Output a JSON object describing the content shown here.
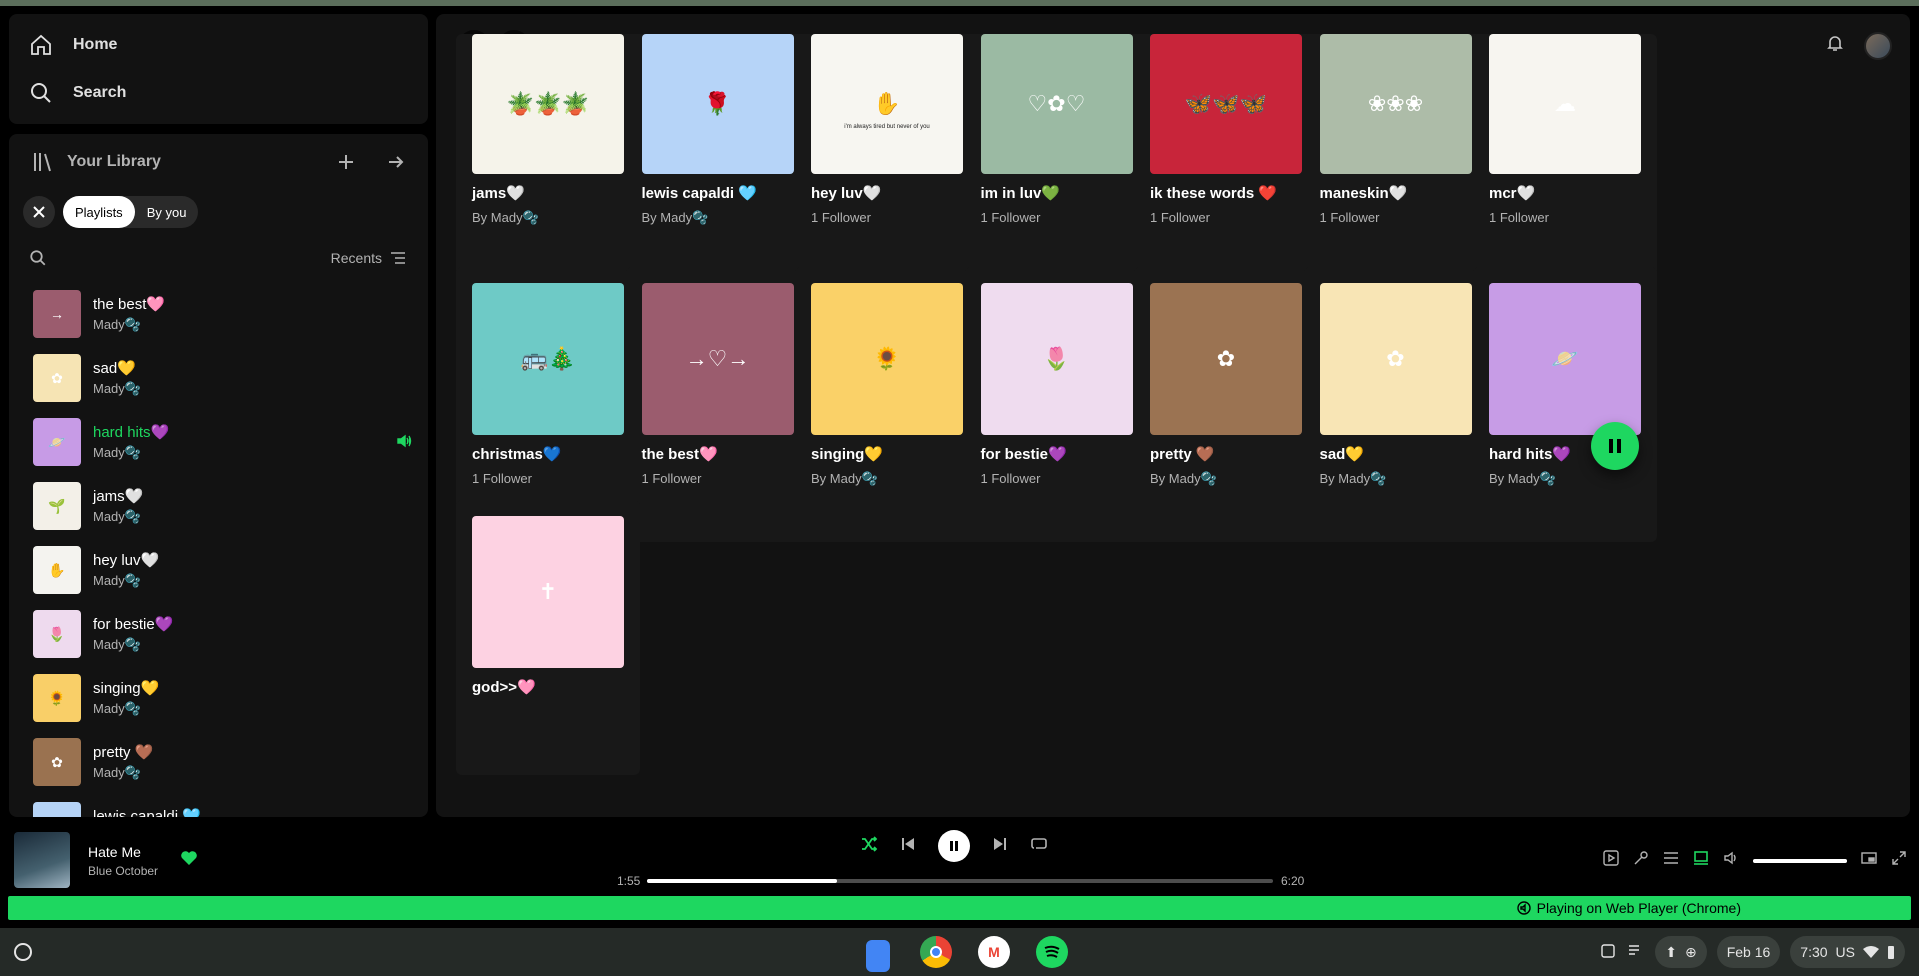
{
  "nav": {
    "home": "Home",
    "search": "Search"
  },
  "library": {
    "title": "Your Library",
    "chips": [
      "Playlists",
      "By you"
    ],
    "sort_label": "Recents",
    "items": [
      {
        "title": "the best🩷",
        "sub": "Mady🫧",
        "color": "#9b5c6e",
        "glyph": "→"
      },
      {
        "title": "sad💛",
        "sub": "Mady🫧",
        "color": "#f6e4b4",
        "glyph": "✿"
      },
      {
        "title": "hard hits💜",
        "sub": "Mady🫧",
        "color": "#c79be6",
        "glyph": "🪐",
        "playing": true
      },
      {
        "title": "jams🤍",
        "sub": "Mady🫧",
        "color": "#f3f0e8",
        "glyph": "🌱"
      },
      {
        "title": "hey luv🤍",
        "sub": "Mady🫧",
        "color": "#f4f3ef",
        "glyph": "✋"
      },
      {
        "title": "for bestie💜",
        "sub": "Mady🫧",
        "color": "#eedaee",
        "glyph": "🌷"
      },
      {
        "title": "singing💛",
        "sub": "Mady🫧",
        "color": "#f9cf68",
        "glyph": "🌻"
      },
      {
        "title": "pretty 🤎",
        "sub": "Mady🫧",
        "color": "#9a7250",
        "glyph": "✿"
      },
      {
        "title": "lewis capaldi 🩵",
        "sub": "Mady🫧",
        "color": "#b5d3f6",
        "glyph": "🌹"
      }
    ]
  },
  "cards": [
    {
      "title": "jams🤍",
      "sub": "By Mady🫧",
      "color": "#f5f3ea",
      "glyph": "🪴🪴🪴"
    },
    {
      "title": "lewis capaldi 🩵",
      "sub": "By Mady🫧",
      "color": "#b6d4f8",
      "glyph": "🌹"
    },
    {
      "title": "hey luv🤍",
      "sub": "1 Follower",
      "color": "#f7f6f1",
      "glyph": "✋",
      "caption": "i'm always tired but never of you"
    },
    {
      "title": "im in luv💚",
      "sub": "1 Follower",
      "color": "#9bbaa3",
      "glyph": "♡✿♡"
    },
    {
      "title": "ik these words ❤️",
      "sub": "1 Follower",
      "color": "#c8253a",
      "glyph": "🦋🦋🦋"
    },
    {
      "title": "maneskin🤍",
      "sub": "1 Follower",
      "color": "#adbca8",
      "glyph": "❀❀❀"
    },
    {
      "title": "mcr🤍",
      "sub": "1 Follower",
      "color": "#f7f5f0",
      "glyph": "☁"
    },
    {
      "title": "christmas💙",
      "sub": "1 Follower",
      "color": "#6ecac6",
      "glyph": "🚌🎄"
    },
    {
      "title": "the best🩷",
      "sub": "1 Follower",
      "color": "#9b5c6e",
      "glyph": "→♡→"
    },
    {
      "title": "singing💛",
      "sub": "By Mady🫧",
      "color": "#fad168",
      "glyph": "🌻"
    },
    {
      "title": "for bestie💜",
      "sub": "1 Follower",
      "color": "#efdcef",
      "glyph": "🌷"
    },
    {
      "title": "pretty 🤎",
      "sub": "By Mady🫧",
      "color": "#9b7352",
      "glyph": "✿"
    },
    {
      "title": "sad💛",
      "sub": "By Mady🫧",
      "color": "#f8e5b5",
      "glyph": "✿"
    },
    {
      "title": "hard hits💜",
      "sub": "By Mady🫧",
      "color": "#c79ce6",
      "glyph": "🪐"
    },
    {
      "title": "god>>🩷",
      "sub": "",
      "color": "#fdd2e2",
      "glyph": "✝"
    }
  ],
  "player": {
    "title": "Hate Me",
    "artist": "Blue October",
    "elapsed": "1:55",
    "duration": "6:20",
    "progress": 0.303,
    "volume": 1.0
  },
  "webplayer": "Playing on Web Player (Chrome)",
  "taskbar": {
    "date": "Feb 16",
    "time": "7:30",
    "region": "US"
  },
  "colors": {
    "accent": "#1ed760",
    "bg": "#121212"
  }
}
